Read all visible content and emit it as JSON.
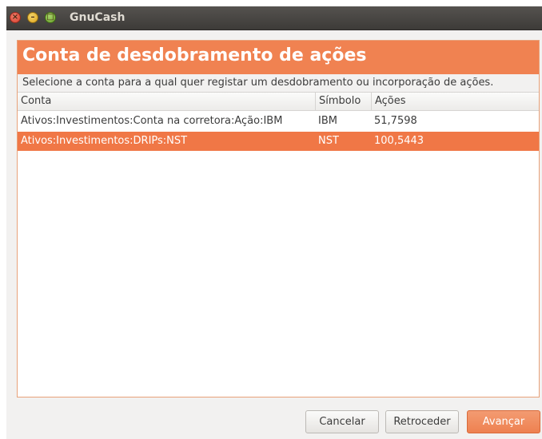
{
  "window": {
    "title": "GnuCash"
  },
  "page": {
    "heading": "Conta de desdobramento de ações",
    "instructions": "Selecione a conta para a qual quer registar um desdobramento ou incorporação de ações."
  },
  "table": {
    "columns": [
      "Conta",
      "Símbolo",
      "Ações"
    ],
    "rows": [
      {
        "account": "Ativos:Investimentos:Conta na corretora:Ação:IBM",
        "symbol": "IBM",
        "shares": "51,7598",
        "selected": false
      },
      {
        "account": "Ativos:Investimentos:DRIPs:NST",
        "symbol": "NST",
        "shares": "100,5443",
        "selected": true
      }
    ]
  },
  "buttons": {
    "cancel": "Cancelar",
    "back": "Retroceder",
    "next": "Avançar"
  },
  "colors": {
    "accent": "#f08251",
    "selection": "#f07746",
    "titlebar": "#3d3b38"
  },
  "icons": {
    "close": "close-icon",
    "minimize": "minimize-icon",
    "maximize": "maximize-icon"
  }
}
